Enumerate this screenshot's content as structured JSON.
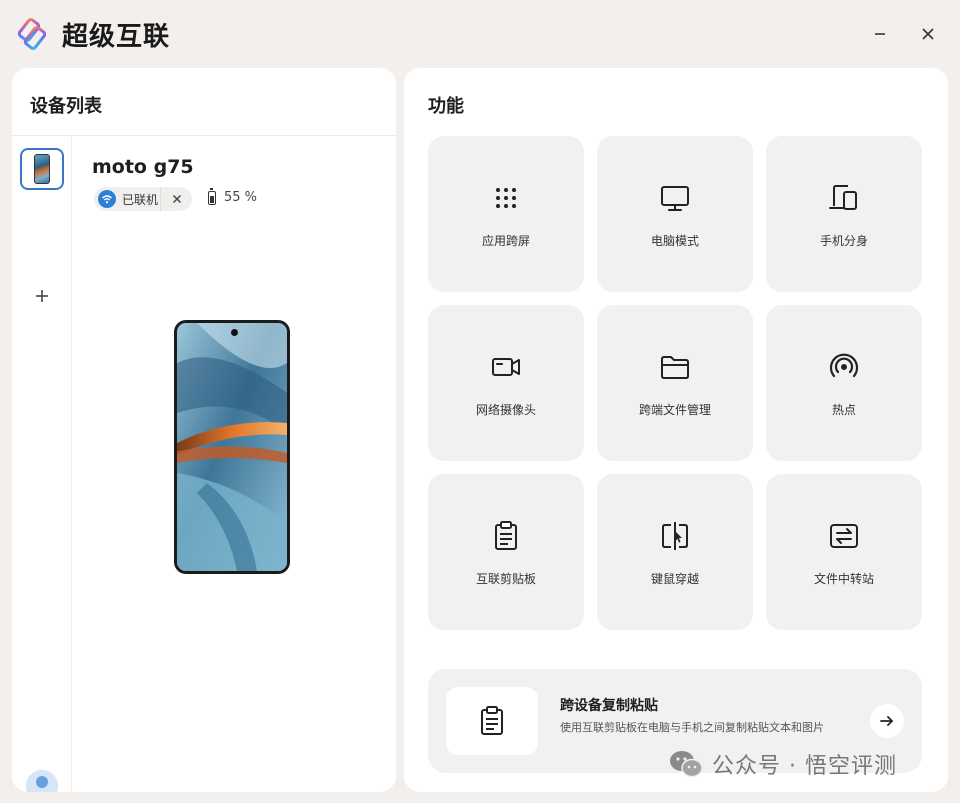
{
  "app": {
    "title": "超级互联",
    "minimize_icon": "minimize-icon",
    "close_icon": "close-icon"
  },
  "left_panel": {
    "header": "设备列表",
    "device": {
      "name": "moto g75",
      "connection_status": "已联机",
      "battery_text": "55 %",
      "battery_level": 0.55
    },
    "rail": {
      "add_icon": "plus-icon",
      "avatar_icon": "user-avatar-icon",
      "settings_icon": "gear-icon"
    }
  },
  "right_panel": {
    "header": "功能",
    "tiles": [
      {
        "label": "应用跨屏",
        "icon": "grid-dots-icon"
      },
      {
        "label": "电脑模式",
        "icon": "monitor-icon"
      },
      {
        "label": "手机分身",
        "icon": "phone-clone-icon"
      },
      {
        "label": "网络摄像头",
        "icon": "camera-icon"
      },
      {
        "label": "跨端文件管理",
        "icon": "folder-icon"
      },
      {
        "label": "热点",
        "icon": "hotspot-icon"
      },
      {
        "label": "互联剪贴板",
        "icon": "clipboard-icon"
      },
      {
        "label": "键鼠穿越",
        "icon": "mouse-crossing-icon"
      },
      {
        "label": "文件中转站",
        "icon": "file-transfer-icon"
      }
    ],
    "banner": {
      "title": "跨设备复制粘贴",
      "description": "使用互联剪贴板在电脑与手机之间复制粘贴文本和图片",
      "icon": "clipboard-icon",
      "arrow_icon": "arrow-right-icon"
    }
  },
  "watermark": {
    "text": "公众号 · 悟空评测"
  },
  "colors": {
    "background": "#f2efed",
    "panel": "#ffffff",
    "tile": "#f3f1ef",
    "accent": "#2f7fd8"
  }
}
